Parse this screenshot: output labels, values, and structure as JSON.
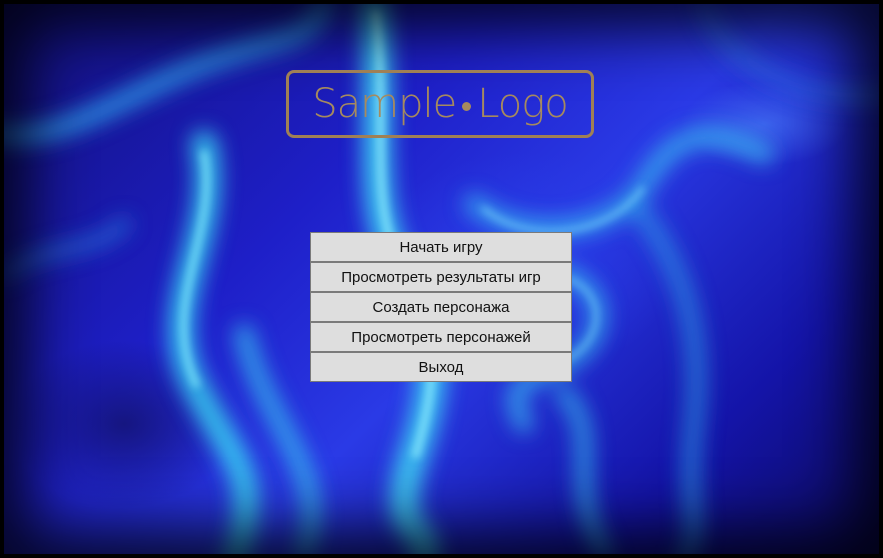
{
  "logo": {
    "word1": "Sample",
    "word2": "Logo"
  },
  "menu": {
    "items": [
      {
        "label": "Начать игру"
      },
      {
        "label": "Просмотреть результаты игр"
      },
      {
        "label": "Создать персонажа"
      },
      {
        "label": "Просмотреть персонажей"
      },
      {
        "label": "Выход"
      }
    ]
  },
  "colors": {
    "logo": "#a68a5e",
    "button_bg": "#dedede",
    "button_border": "#7a7a7a",
    "background_primary": "#1e1fc8",
    "background_highlight": "#3fd4f0"
  }
}
